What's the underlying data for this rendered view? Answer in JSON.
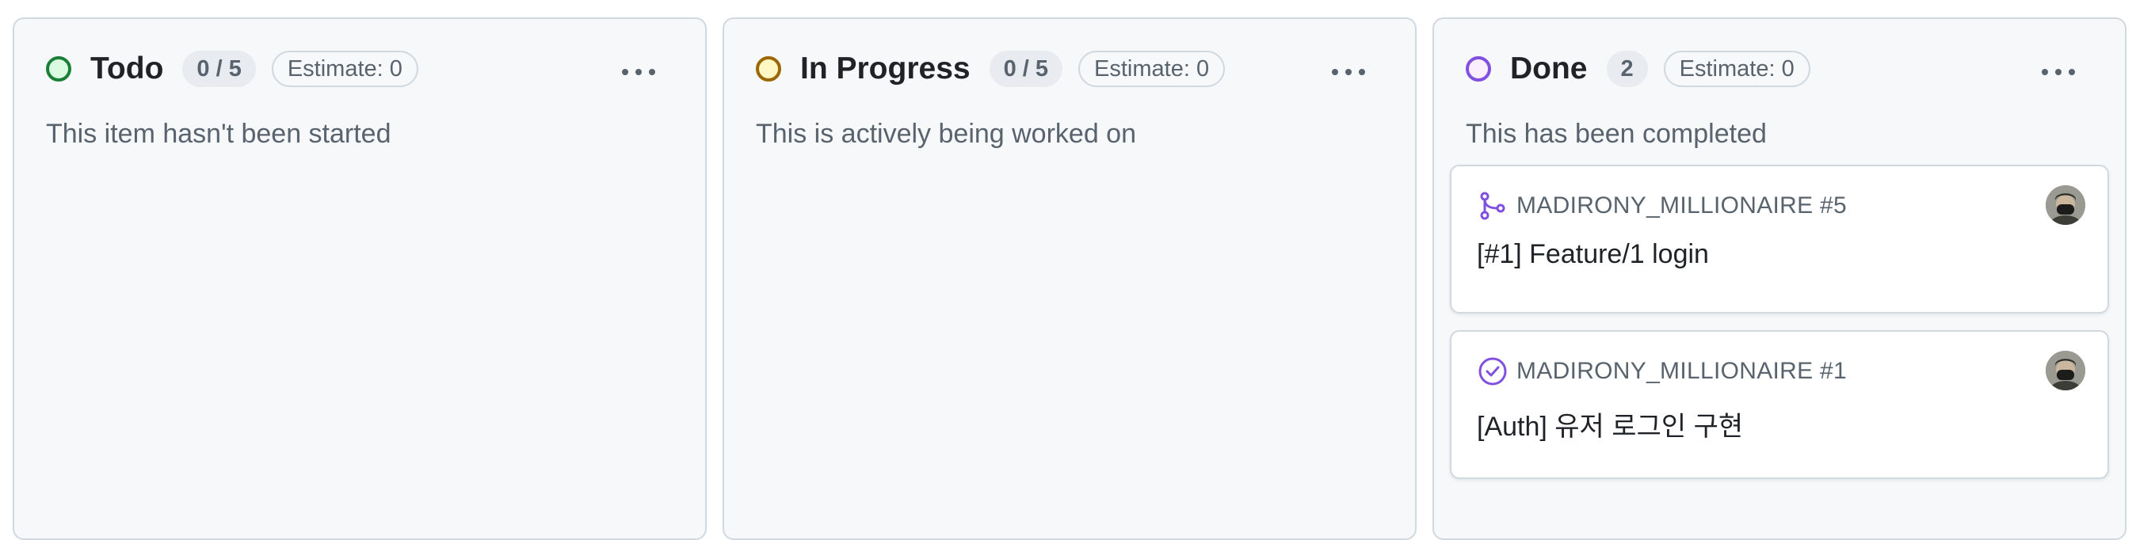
{
  "columns": [
    {
      "title": "Todo",
      "count": "0 / 5",
      "estimate": "Estimate: 0",
      "description": "This item hasn't been started",
      "ring_color": "#1a7f37",
      "ring_fill": "#dafbe1",
      "more_icon": "kebab-horizontal-icon",
      "cards": []
    },
    {
      "title": "In Progress",
      "count": "0 / 5",
      "estimate": "Estimate: 0",
      "description": "This is actively being worked on",
      "ring_color": "#9a6700",
      "ring_fill": "#fff8c5",
      "more_icon": "kebab-horizontal-icon",
      "cards": []
    },
    {
      "title": "Done",
      "count": "2",
      "estimate": "Estimate: 0",
      "description": "This has been completed",
      "ring_color": "#8250df",
      "ring_fill": "#fbefff",
      "more_icon": "kebab-horizontal-icon",
      "cards": [
        {
          "icon": "git-merge-icon",
          "repo": "MADIRONY_MILLIONAIRE #5",
          "title": "[#1] Feature/1 login"
        },
        {
          "icon": "issue-closed-icon",
          "repo": "MADIRONY_MILLIONAIRE #1",
          "title": "[Auth] 유저 로그인 구현"
        }
      ]
    }
  ],
  "accent_purple": "#8250df"
}
